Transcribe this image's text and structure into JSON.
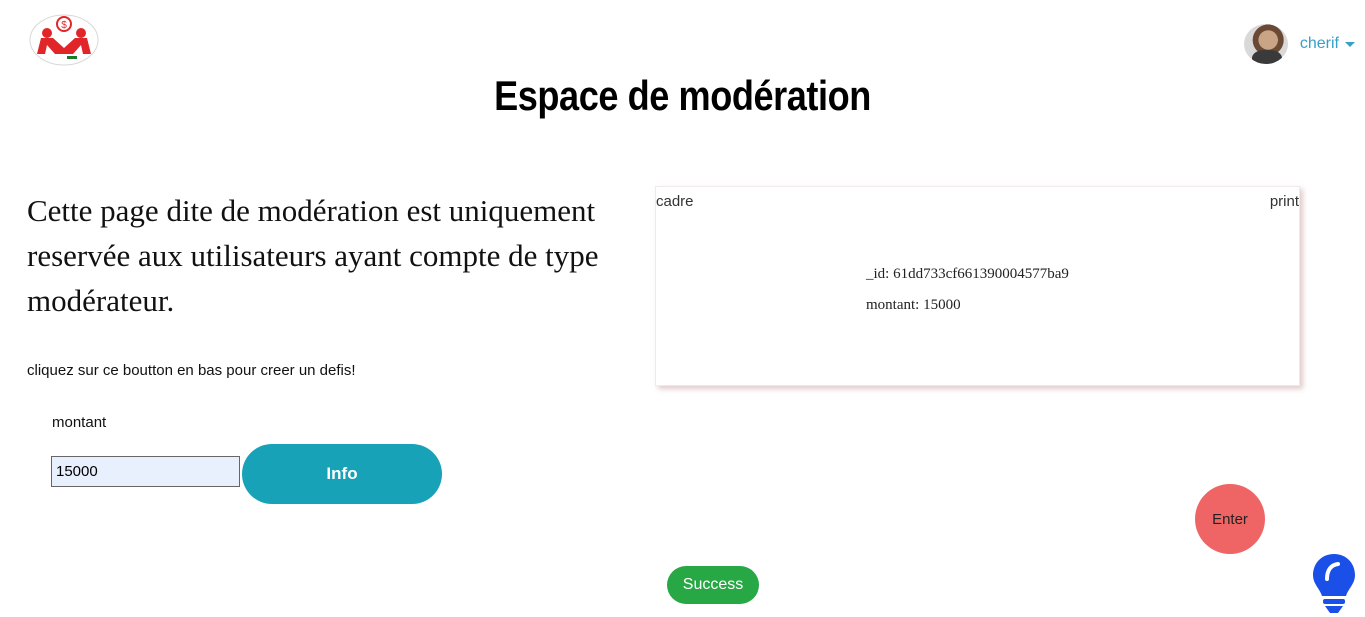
{
  "header": {
    "logo_icon": "brand-logo-icon",
    "user": {
      "name": "cherif",
      "avatar_icon": "user-avatar"
    }
  },
  "main": {
    "title": "Espace de modération",
    "intro": "Cette page dite de modération est uniquement reservée aux utilisateurs ayant compte de type modérateur.",
    "hint": "cliquez sur ce boutton en bas pour creer un defis!",
    "amount_label": "montant",
    "amount_value": "15000",
    "info_label": "Info"
  },
  "card": {
    "left_label": "cadre",
    "right_label": "print",
    "id_line": "_id: 61dd733cf661390004577ba9",
    "amount_line": "montant: 15000"
  },
  "actions": {
    "enter_label": "Enter",
    "success_label": "Success",
    "bulb_icon": "lightbulb-icon"
  },
  "colors": {
    "accent": "#17a2b8",
    "success": "#28a745",
    "enter": "#ef6565",
    "link": "#35a0c8",
    "bulb": "#1a4fe8"
  }
}
